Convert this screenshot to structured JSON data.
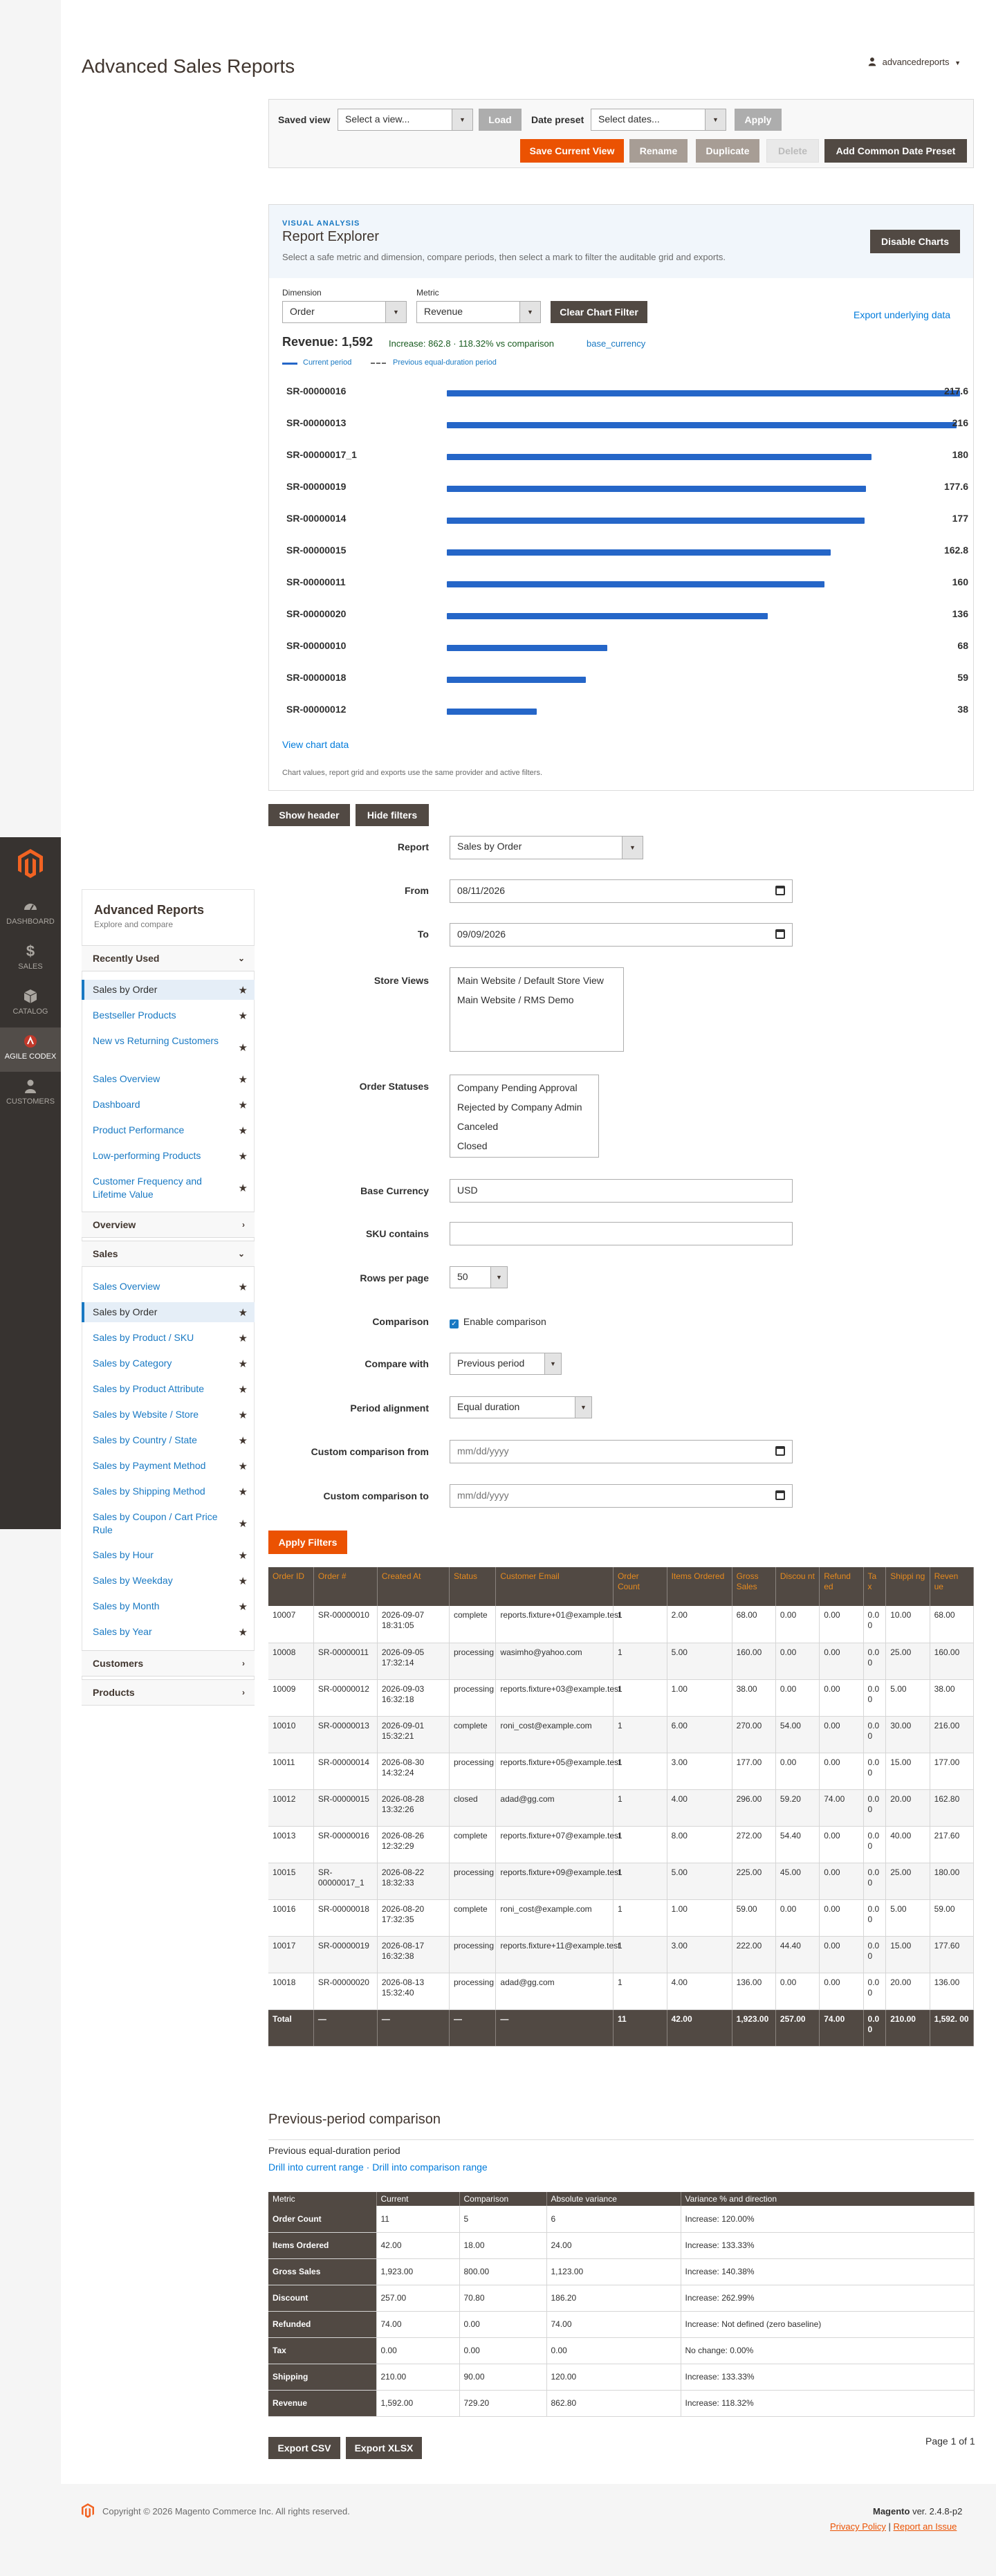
{
  "nav": {
    "items": [
      {
        "label": "DASHBOARD",
        "icon": "dashboard-icon"
      },
      {
        "label": "SALES",
        "icon": "dollar-icon"
      },
      {
        "label": "CATALOG",
        "icon": "box-icon"
      },
      {
        "label": "AGILE CODEX",
        "icon": "agile-codex-icon"
      },
      {
        "label": "CUSTOMERS",
        "icon": "person-icon"
      }
    ]
  },
  "header": {
    "title": "Advanced Sales Reports",
    "user": "advancedreports"
  },
  "saved_view": {
    "label": "Saved view",
    "placeholder": "Select a view...",
    "load": "Load",
    "date_preset_label": "Date preset",
    "date_preset_placeholder": "Select dates...",
    "apply": "Apply",
    "save_current": "Save Current View",
    "rename": "Rename",
    "duplicate": "Duplicate",
    "delete": "Delete",
    "add_common": "Add Common Date Preset"
  },
  "explorer": {
    "eyebrow": "VISUAL ANALYSIS",
    "title": "Report Explorer",
    "subtitle": "Select a safe metric and dimension, compare periods, then select a mark to filter the auditable grid and exports.",
    "disable_charts": "Disable Charts",
    "dimension_label": "Dimension",
    "dimension_value": "Order",
    "metric_label": "Metric",
    "metric_value": "Revenue",
    "clear_filter": "Clear Chart Filter",
    "export_link": "Export underlying data",
    "summary_value": "Revenue: 1,592",
    "summary_change": "Increase: 862.8 · 118.32% vs comparison",
    "summary_currency": "base_currency",
    "legend_current": "Current period",
    "legend_previous": "Previous equal-duration period",
    "view_chart_data": "View chart data",
    "footnote": "Chart values, report grid and exports use the same provider and active filters."
  },
  "chart_data": {
    "type": "bar",
    "title": "Revenue: 1,592",
    "categories": [
      "SR-00000016",
      "SR-00000013",
      "SR-00000017_1",
      "SR-00000019",
      "SR-00000014",
      "SR-00000015",
      "SR-00000011",
      "SR-00000020",
      "SR-00000010",
      "SR-00000018",
      "SR-00000012"
    ],
    "values": [
      217.6,
      216,
      180,
      177.6,
      177,
      162.8,
      160,
      136,
      68,
      59,
      38
    ],
    "value_labels": [
      "217.6",
      "216",
      "180",
      "177.6",
      "177",
      "162.8",
      "160",
      "136",
      "68",
      "59",
      "38"
    ],
    "series": [
      {
        "name": "Current period",
        "values": [
          217.6,
          216,
          180,
          177.6,
          177,
          162.8,
          160,
          136,
          68,
          59,
          38
        ]
      }
    ],
    "xlim": [
      0,
      217.6
    ],
    "colors": {
      "current": "#2566c8"
    }
  },
  "toggles": {
    "show_header": "Show header",
    "hide_filters": "Hide filters"
  },
  "sidebar": {
    "title": "Advanced Reports",
    "subtitle": "Explore and compare",
    "sections": [
      {
        "label": "Recently Used",
        "expanded": true
      },
      {
        "label": "Overview",
        "expanded": false
      },
      {
        "label": "Sales",
        "expanded": true
      },
      {
        "label": "Customers",
        "expanded": false
      },
      {
        "label": "Products",
        "expanded": false
      }
    ],
    "recent": [
      "Sales by Order",
      "Bestseller Products",
      "New vs Returning Customers",
      "Sales Overview",
      "Dashboard",
      "Product Performance",
      "Low-performing Products",
      "Customer Frequency and Lifetime Value"
    ],
    "sales": [
      "Sales Overview",
      "Sales by Order",
      "Sales by Product / SKU",
      "Sales by Category",
      "Sales by Product Attribute",
      "Sales by Website / Store",
      "Sales by Country / State",
      "Sales by Payment Method",
      "Sales by Shipping Method",
      "Sales by Coupon / Cart Price Rule",
      "Sales by Hour",
      "Sales by Weekday",
      "Sales by Month",
      "Sales by Year"
    ]
  },
  "form": {
    "report_label": "Report",
    "report_value": "Sales by Order",
    "from_label": "From",
    "from_value": "08/11/2026",
    "to_label": "To",
    "to_value": "09/09/2026",
    "store_views_label": "Store Views",
    "store_views": [
      "Main Website / Default Store View",
      "Main Website / RMS Demo"
    ],
    "order_statuses_label": "Order Statuses",
    "order_statuses": [
      "Company Pending Approval",
      "Rejected by Company Admin",
      "Canceled",
      "Closed"
    ],
    "base_currency_label": "Base Currency",
    "base_currency_value": "USD",
    "sku_label": "SKU contains",
    "rows_label": "Rows per page",
    "rows_value": "50",
    "comparison_label": "Comparison",
    "comparison_check": "Enable comparison",
    "compare_with_label": "Compare with",
    "compare_with_value": "Previous period",
    "period_alignment_label": "Period alignment",
    "period_alignment_value": "Equal duration",
    "custom_from_label": "Custom comparison from",
    "custom_to_label": "Custom comparison to",
    "date_placeholder": "mm/dd/yyyy",
    "apply_filters": "Apply Filters"
  },
  "grid": {
    "headers": [
      "Order ID",
      "Order #",
      "Created At",
      "Status",
      "Customer Email",
      "Order Count",
      "Items Ordered",
      "Gross Sales",
      "Discou nt",
      "Refund ed",
      "Ta x",
      "Shippi ng",
      "Reven ue"
    ],
    "rows": [
      [
        "10007",
        "SR-00000010",
        "2026-09-07 18:31:05",
        "complete",
        "reports.fixture+01@example.test",
        "1",
        "2.00",
        "68.00",
        "0.00",
        "0.00",
        "0.0 0",
        "10.00",
        "68.00"
      ],
      [
        "10008",
        "SR-00000011",
        "2026-09-05 17:32:14",
        "processing",
        "wasimho@yahoo.com",
        "1",
        "5.00",
        "160.00",
        "0.00",
        "0.00",
        "0.0 0",
        "25.00",
        "160.00"
      ],
      [
        "10009",
        "SR-00000012",
        "2026-09-03 16:32:18",
        "processing",
        "reports.fixture+03@example.test",
        "1",
        "1.00",
        "38.00",
        "0.00",
        "0.00",
        "0.0 0",
        "5.00",
        "38.00"
      ],
      [
        "10010",
        "SR-00000013",
        "2026-09-01 15:32:21",
        "complete",
        "roni_cost@example.com",
        "1",
        "6.00",
        "270.00",
        "54.00",
        "0.00",
        "0.0 0",
        "30.00",
        "216.00"
      ],
      [
        "10011",
        "SR-00000014",
        "2026-08-30 14:32:24",
        "processing",
        "reports.fixture+05@example.test",
        "1",
        "3.00",
        "177.00",
        "0.00",
        "0.00",
        "0.0 0",
        "15.00",
        "177.00"
      ],
      [
        "10012",
        "SR-00000015",
        "2026-08-28 13:32:26",
        "closed",
        "adad@gg.com",
        "1",
        "4.00",
        "296.00",
        "59.20",
        "74.00",
        "0.0 0",
        "20.00",
        "162.80"
      ],
      [
        "10013",
        "SR-00000016",
        "2026-08-26 12:32:29",
        "complete",
        "reports.fixture+07@example.test",
        "1",
        "8.00",
        "272.00",
        "54.40",
        "0.00",
        "0.0 0",
        "40.00",
        "217.60"
      ],
      [
        "10015",
        "SR-00000017_1",
        "2026-08-22 18:32:33",
        "processing",
        "reports.fixture+09@example.test",
        "1",
        "5.00",
        "225.00",
        "45.00",
        "0.00",
        "0.0 0",
        "25.00",
        "180.00"
      ],
      [
        "10016",
        "SR-00000018",
        "2026-08-20 17:32:35",
        "complete",
        "roni_cost@example.com",
        "1",
        "1.00",
        "59.00",
        "0.00",
        "0.00",
        "0.0 0",
        "5.00",
        "59.00"
      ],
      [
        "10017",
        "SR-00000019",
        "2026-08-17 16:32:38",
        "processing",
        "reports.fixture+11@example.test",
        "1",
        "3.00",
        "222.00",
        "44.40",
        "0.00",
        "0.0 0",
        "15.00",
        "177.60"
      ],
      [
        "10018",
        "SR-00000020",
        "2026-08-13 15:32:40",
        "processing",
        "adad@gg.com",
        "1",
        "4.00",
        "136.00",
        "0.00",
        "0.00",
        "0.0 0",
        "20.00",
        "136.00"
      ]
    ],
    "totals": [
      "Total",
      "—",
      "—",
      "—",
      "—",
      "11",
      "42.00",
      "1,923.00",
      "257.00",
      "74.00",
      "0.0 0",
      "210.00",
      "1,592. 00"
    ]
  },
  "comparison": {
    "title": "Previous-period comparison",
    "subtitle": "Previous equal-duration period",
    "drill_current": "Drill into current range",
    "sep": " · ",
    "drill_comparison": "Drill into comparison range",
    "headers": [
      "Metric",
      "Current",
      "Comparison",
      "Absolute variance",
      "Variance % and direction"
    ],
    "rows": [
      [
        "Order Count",
        "11",
        "5",
        "6",
        "Increase: 120.00%"
      ],
      [
        "Items Ordered",
        "42.00",
        "18.00",
        "24.00",
        "Increase: 133.33%"
      ],
      [
        "Gross Sales",
        "1,923.00",
        "800.00",
        "1,123.00",
        "Increase: 140.38%"
      ],
      [
        "Discount",
        "257.00",
        "70.80",
        "186.20",
        "Increase: 262.99%"
      ],
      [
        "Refunded",
        "74.00",
        "0.00",
        "74.00",
        "Increase: Not defined (zero baseline)"
      ],
      [
        "Tax",
        "0.00",
        "0.00",
        "0.00",
        "No change: 0.00%"
      ],
      [
        "Shipping",
        "210.00",
        "90.00",
        "120.00",
        "Increase: 133.33%"
      ],
      [
        "Revenue",
        "1,592.00",
        "729.20",
        "862.80",
        "Increase: 118.32%"
      ]
    ]
  },
  "pager": "Page 1 of 1",
  "exports": {
    "csv": "Export CSV",
    "xlsx": "Export XLSX"
  },
  "footer": {
    "copyright": "Copyright © 2026 Magento Commerce Inc. All rights reserved.",
    "brand": "Magento",
    "version": " ver. 2.4.8-p2",
    "privacy": "Privacy Policy",
    "divider": " | ",
    "report_issue": "Report an Issue"
  }
}
